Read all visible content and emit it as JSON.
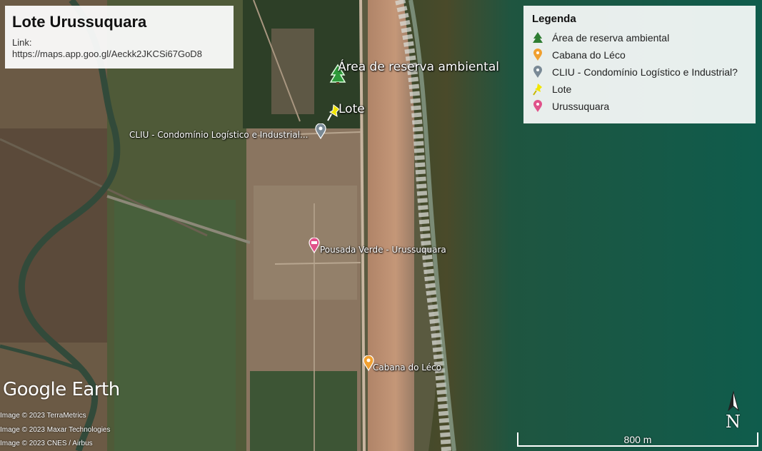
{
  "title": "Lote Urussuquara",
  "link_label": "Link:",
  "link_url": "https://maps.app.goo.gl/Aeckk2JKCSi67GoD8",
  "legend": {
    "heading": "Legenda",
    "items": [
      {
        "label": "Área de reserva ambiental",
        "icon": "tree-icon",
        "color": "#2e7d32"
      },
      {
        "label": "Cabana do Léco",
        "icon": "pin-icon",
        "color": "#f0a030"
      },
      {
        "label": "CLIU - Condomínio Logístico e Industrial?",
        "icon": "pin-icon",
        "color": "#7a8a96"
      },
      {
        "label": "Lote",
        "icon": "pushpin-icon",
        "color": "#f2e600"
      },
      {
        "label": "Urussuquara",
        "icon": "pin-icon",
        "color": "#e0528a"
      }
    ]
  },
  "markers": {
    "reserva": "Área de reserva ambiental",
    "lote": "Lote",
    "cliu": "CLIU - Condomínio Logístico e Industrial...",
    "pousada": "Pousada Verde - Urussuquara",
    "cabana": "Cabana do Léco"
  },
  "brand": "Google Earth",
  "credits": [
    "Image © 2023 TerraMetrics",
    "Image © 2023 Maxar Technologies",
    "Image © 2023 CNES / Airbus"
  ],
  "scale_label": "800 m",
  "north_label": "N"
}
